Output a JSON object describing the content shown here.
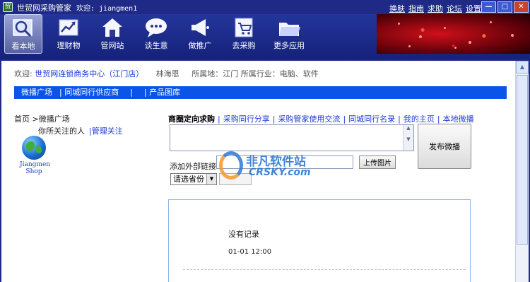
{
  "titlebar": {
    "app_name": "世贸网采购管家",
    "welcome": "欢迎: jiangmen1",
    "links": [
      "换肤",
      "指南",
      "求助",
      "论坛",
      "设置"
    ]
  },
  "toolbar": {
    "items": [
      {
        "label": "看本地",
        "icon": "magnifier-icon"
      },
      {
        "label": "理财物",
        "icon": "chart-icon"
      },
      {
        "label": "管网站",
        "icon": "house-icon"
      },
      {
        "label": "谈生意",
        "icon": "chat-bubble-icon"
      },
      {
        "label": "做推广",
        "icon": "megaphone-icon"
      },
      {
        "label": "去采购",
        "icon": "shopping-cart-icon"
      },
      {
        "label": "更多应用",
        "icon": "folder-icon"
      }
    ]
  },
  "info": {
    "welcome_label": "欢迎:",
    "org": "世贸网连锁商务中心（江门店）",
    "person": "林海恩",
    "location": "所属地：江门",
    "industry": "所属行业：电脑、软件"
  },
  "bluebar": {
    "items": [
      "微播广场",
      "| 同城同行供应商",
      "|",
      "| 产品图库"
    ]
  },
  "breadcrumb": "首页 >微播广场",
  "follow": {
    "label": "你所关注的人",
    "manage": "|管理关注"
  },
  "shop": {
    "line1": "Jiangmen",
    "line2": "Shop"
  },
  "tabs": {
    "active": "商圈定向求购",
    "items": [
      "采购同行分享",
      "采购管家使用交流",
      "同城同行名录",
      "我的主页",
      "本地微播"
    ]
  },
  "post": {
    "publish_label": "发布微播",
    "link_label": "添加外部链接:",
    "link_value": "",
    "upload_label": "上传图片",
    "province_placeholder": "请选省份"
  },
  "watermark": {
    "line1": "非凡软件站",
    "line2": "CRSKY.com"
  },
  "feed": {
    "empty_text": "没有记录",
    "time": "01-01 12:00"
  },
  "colors": {
    "titlebar": "#1e2a86",
    "bluebar": "#0a55e8",
    "link": "#1c3ad6"
  }
}
